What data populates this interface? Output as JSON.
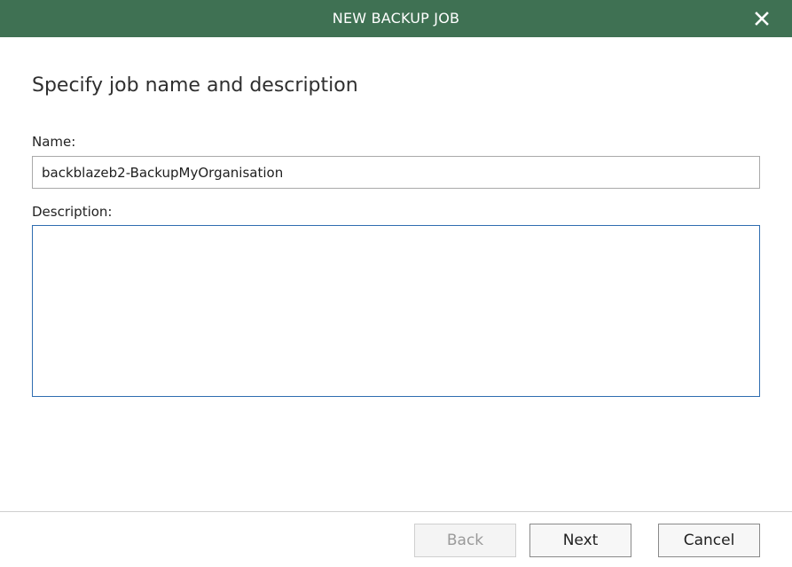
{
  "window": {
    "title": "NEW BACKUP JOB",
    "close_icon": "close-icon"
  },
  "form": {
    "heading": "Specify job name and description",
    "name_label": "Name:",
    "name_value": "backblazeb2-BackupMyOrganisation",
    "description_label": "Description:",
    "description_value": ""
  },
  "footer": {
    "back_label": "Back",
    "back_enabled": false,
    "next_label": "Next",
    "cancel_label": "Cancel"
  },
  "colors": {
    "titlebar": "#3f7153",
    "focus_border": "#2f6db0"
  }
}
